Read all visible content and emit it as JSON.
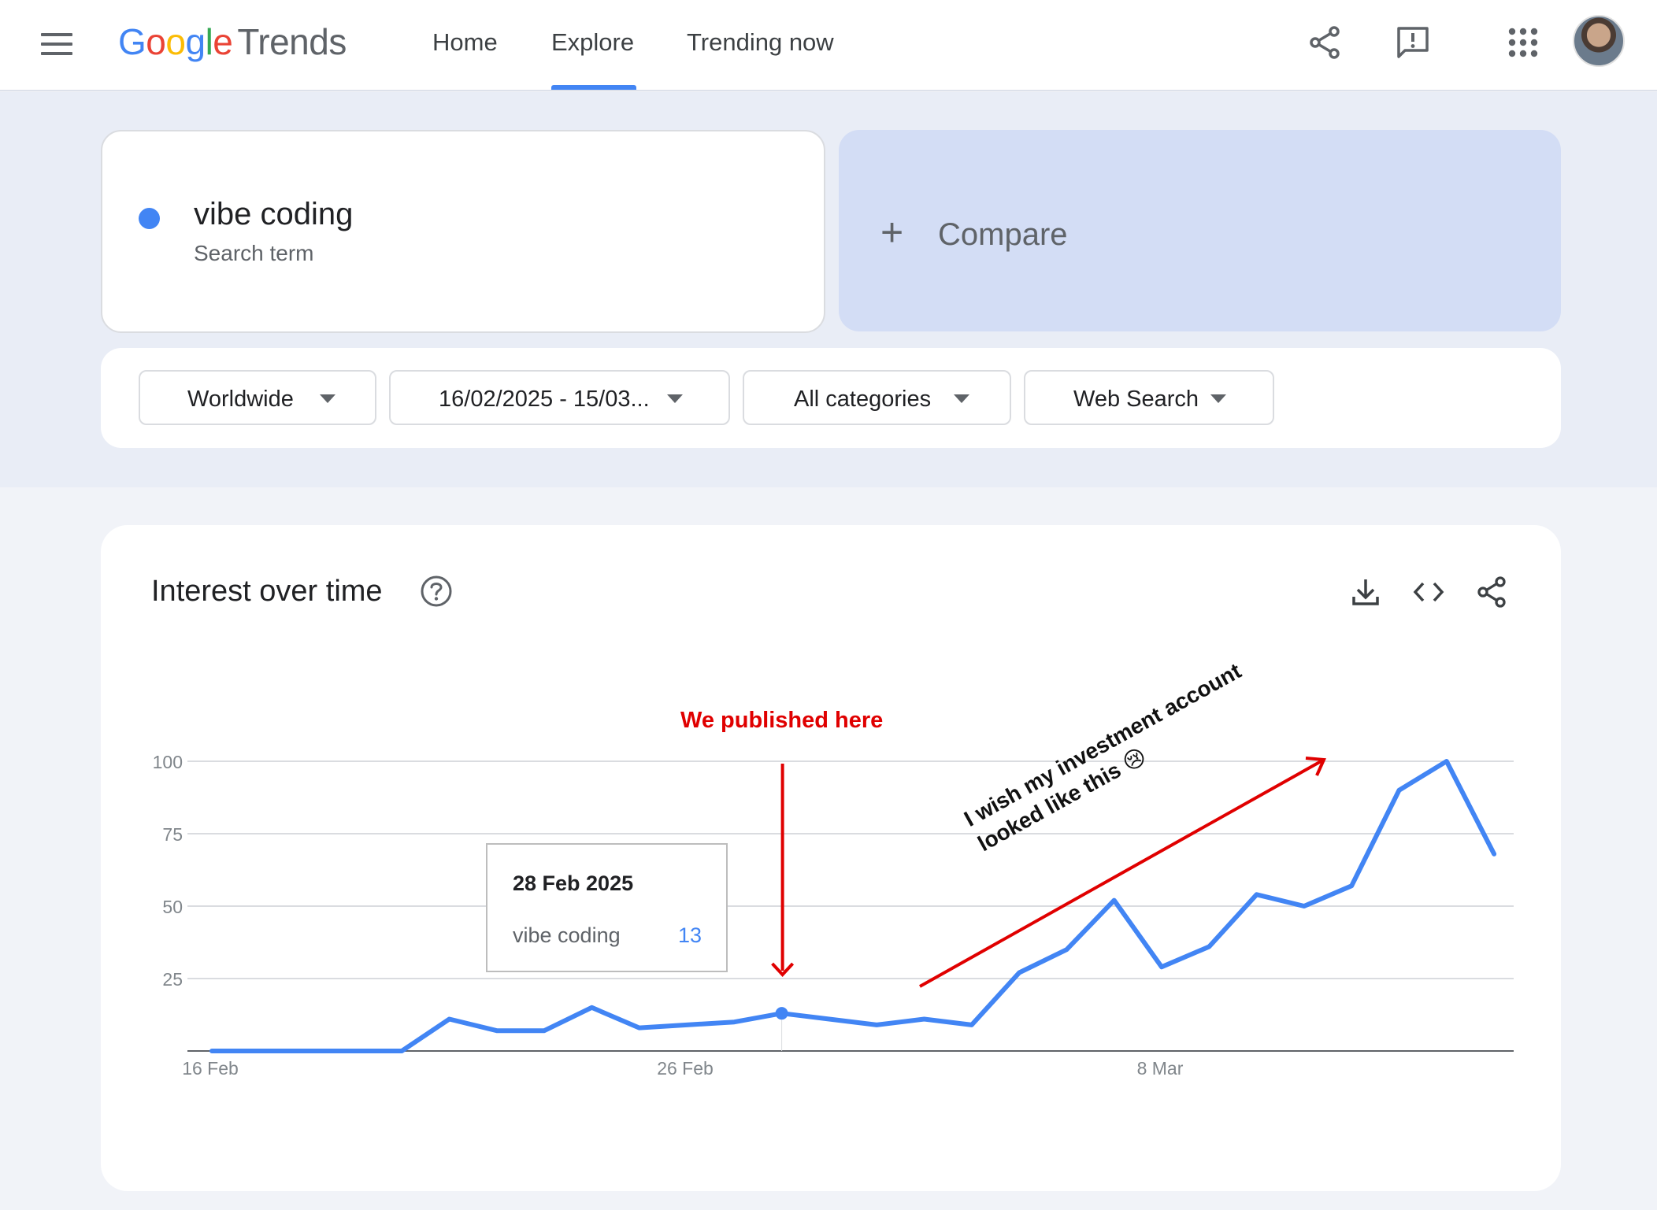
{
  "header": {
    "logo_google": [
      "G",
      "o",
      "o",
      "g",
      "l",
      "e"
    ],
    "logo_product": "Trends",
    "nav": {
      "home": "Home",
      "explore": "Explore",
      "trending": "Trending now"
    },
    "active_tab": "Explore",
    "icons": [
      "menu-icon",
      "share-icon",
      "feedback-icon",
      "apps-grid-icon",
      "avatar"
    ]
  },
  "search": {
    "term": "vibe coding",
    "term_type": "Search term",
    "term_color": "#4285f4",
    "compare_label": "Compare"
  },
  "filters": {
    "region": "Worldwide",
    "date_range": "16/02/2025 - 15/03...",
    "category": "All categories",
    "property": "Web Search"
  },
  "chart": {
    "title": "Interest over time",
    "tooltip": {
      "date": "28 Feb 2025",
      "series": "vibe coding",
      "value": "13"
    },
    "annotation_published": "We published here",
    "annotation_wish": "I wish my investment account looked like this 😢",
    "icons": [
      "help-icon",
      "download-icon",
      "embed-icon",
      "share-icon"
    ]
  },
  "chart_data": {
    "type": "line",
    "title": "Interest over time",
    "series": [
      {
        "name": "vibe coding",
        "color": "#4285f4",
        "x": [
          "16 Feb",
          "17 Feb",
          "18 Feb",
          "19 Feb",
          "20 Feb",
          "21 Feb",
          "22 Feb",
          "23 Feb",
          "24 Feb",
          "25 Feb",
          "26 Feb",
          "27 Feb",
          "28 Feb",
          "1 Mar",
          "2 Mar",
          "3 Mar",
          "4 Mar",
          "5 Mar",
          "6 Mar",
          "7 Mar",
          "8 Mar",
          "9 Mar",
          "10 Mar",
          "11 Mar",
          "12 Mar",
          "13 Mar",
          "14 Mar",
          "15 Mar"
        ],
        "values": [
          0,
          0,
          0,
          0,
          0,
          11,
          7,
          7,
          15,
          8,
          9,
          10,
          13,
          11,
          9,
          11,
          9,
          27,
          35,
          52,
          29,
          36,
          54,
          50,
          57,
          90,
          100,
          68
        ]
      }
    ],
    "x_tick_labels": [
      "16 Feb",
      "26 Feb",
      "8 Mar"
    ],
    "x_tick_index": [
      0,
      10,
      20
    ],
    "y_ticks": [
      25,
      50,
      75,
      100
    ],
    "ylim": [
      0,
      100
    ],
    "grid": true,
    "highlight_index": 12
  }
}
